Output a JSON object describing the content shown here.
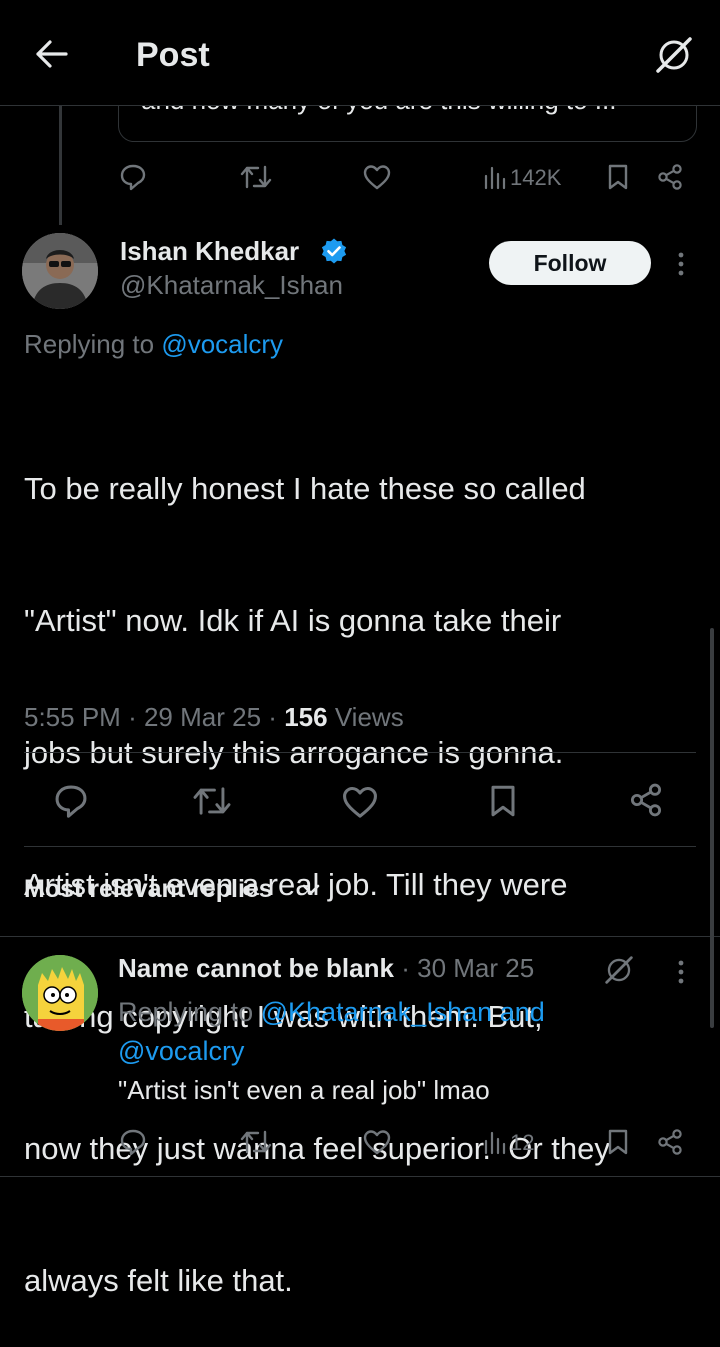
{
  "header": {
    "title": "Post"
  },
  "quoted": {
    "partial_text": "and how many of you are this willing to ...",
    "views": "142K"
  },
  "post": {
    "author_name": "Ishan Khedkar",
    "author_handle": "@Khatarnak_Ishan",
    "follow_label": "Follow",
    "replying_prefix": "Replying to",
    "replying_to": "@vocalcry",
    "body_lines": [
      "To be really honest I hate these so called",
      "\"Artist\" now. Idk if AI is gonna take their",
      "jobs but surely this arrogance is gonna.",
      "Artist isn't even a real job. Till they were",
      "talking copyright I was with them. But,",
      "now they just wanna feel superior.  Or they",
      "always felt like that."
    ],
    "time": "5:55 PM",
    "date": "29 Mar 25",
    "views_count": "156",
    "views_label": "Views"
  },
  "replies_section": {
    "sort_label": "Most relevant replies"
  },
  "reply": {
    "author_name": "Name cannot be blank",
    "date": "30 Mar 25",
    "replying_prefix": "Replying to",
    "replying_to_1": "@Khatarnak_Ishan",
    "and_label": "and",
    "replying_to_2": "@vocalcry",
    "text": "\"Artist isn't even a real job\" lmao",
    "views": "12"
  },
  "colors": {
    "background": "#000000",
    "text": "#e7e9ea",
    "muted": "#71767b",
    "link": "#1d9bf0",
    "verified": "#1d9bf0",
    "divider": "#2f3336"
  }
}
